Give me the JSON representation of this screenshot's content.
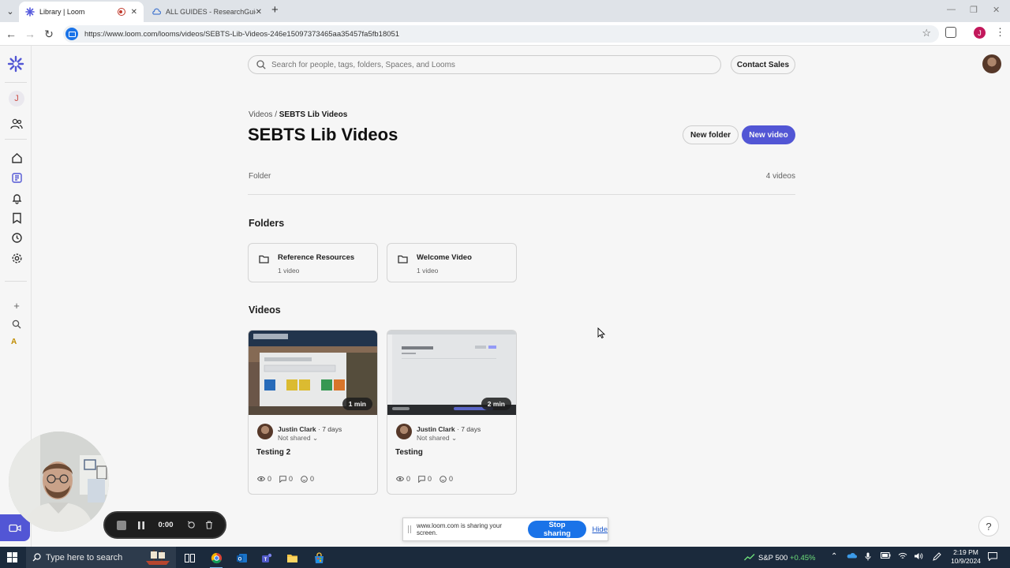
{
  "browser": {
    "tabs": [
      {
        "title": "Library | Loom",
        "active": true
      },
      {
        "title": "ALL GUIDES - ResearchGuides",
        "active": false
      }
    ],
    "url": "https://www.loom.com/looms/videos/SEBTS-Lib-Videos-246e15097373465aa35457fa5fb18051",
    "profile_initial": "J"
  },
  "sidebar": {
    "workspace_initial": "J",
    "bottom_initial": "A"
  },
  "header": {
    "search_placeholder": "Search for people, tags, folders, Spaces, and Looms",
    "contact_sales": "Contact Sales"
  },
  "breadcrumb": {
    "root": "Videos",
    "separator": "/",
    "current": "SEBTS Lib Videos"
  },
  "page": {
    "title": "SEBTS Lib Videos",
    "new_folder": "New folder",
    "new_video": "New video",
    "type_label": "Folder",
    "video_count": "4 videos"
  },
  "folders": {
    "heading": "Folders",
    "items": [
      {
        "name": "Reference Resources",
        "count": "1 video"
      },
      {
        "name": "Welcome Video",
        "count": "1 video"
      }
    ]
  },
  "videos": {
    "heading": "Videos",
    "items": [
      {
        "title": "Testing 2",
        "author": "Justin Clark",
        "age": "7 days",
        "sharing": "Not shared",
        "duration": "1 min",
        "views": "0",
        "comments": "0",
        "reactions": "0"
      },
      {
        "title": "Testing",
        "author": "Justin Clark",
        "age": "7 days",
        "sharing": "Not shared",
        "duration": "2 min",
        "views": "0",
        "comments": "0",
        "reactions": "0"
      }
    ]
  },
  "recorder": {
    "timer": "0:00"
  },
  "share_bar": {
    "message": "www.loom.com is sharing your screen.",
    "stop": "Stop sharing",
    "hide": "Hide"
  },
  "help": "?",
  "taskbar": {
    "search_placeholder": "Type here to search",
    "stock_name": "S&P 500",
    "stock_change": "+0.45%",
    "time": "2:19 PM",
    "date": "10/9/2024"
  },
  "colors": {
    "accent": "#565ADD",
    "share_blue": "#1a73e8",
    "taskbar": "#1b2a3c"
  }
}
